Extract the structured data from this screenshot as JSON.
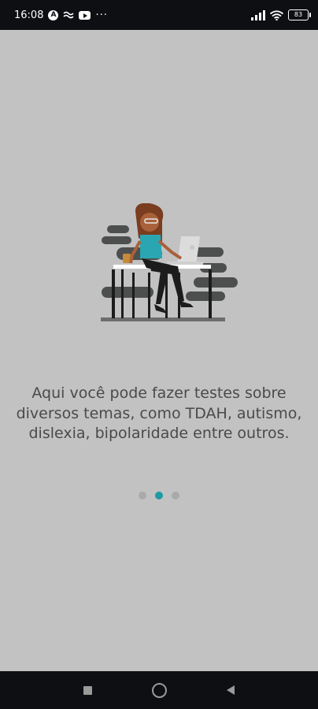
{
  "status_bar": {
    "time": "16:08",
    "app_badge": "A",
    "more_indicator": "···",
    "battery_level": "83",
    "icons": [
      "auto-mode-icon",
      "cast-icon",
      "youtube-icon",
      "signal-icon",
      "wifi-icon",
      "battery-icon"
    ]
  },
  "onboarding": {
    "illustration": "woman-working-at-laptop-illustration",
    "message": "Aqui você pode fazer testes sobre diversos temas, como TDAH, autismo, dislexia, bipolaridade entre outros.",
    "page_indicator": {
      "total": 3,
      "active_index": 1
    }
  },
  "nav_bar": {
    "buttons": [
      "recents-square-icon",
      "home-circle-icon",
      "back-triangle-icon"
    ]
  },
  "colors": {
    "background": "#c2c2c2",
    "accent": "#1f9aa3",
    "text": "#4a4a4a",
    "system_bars": "#0d0f12"
  }
}
